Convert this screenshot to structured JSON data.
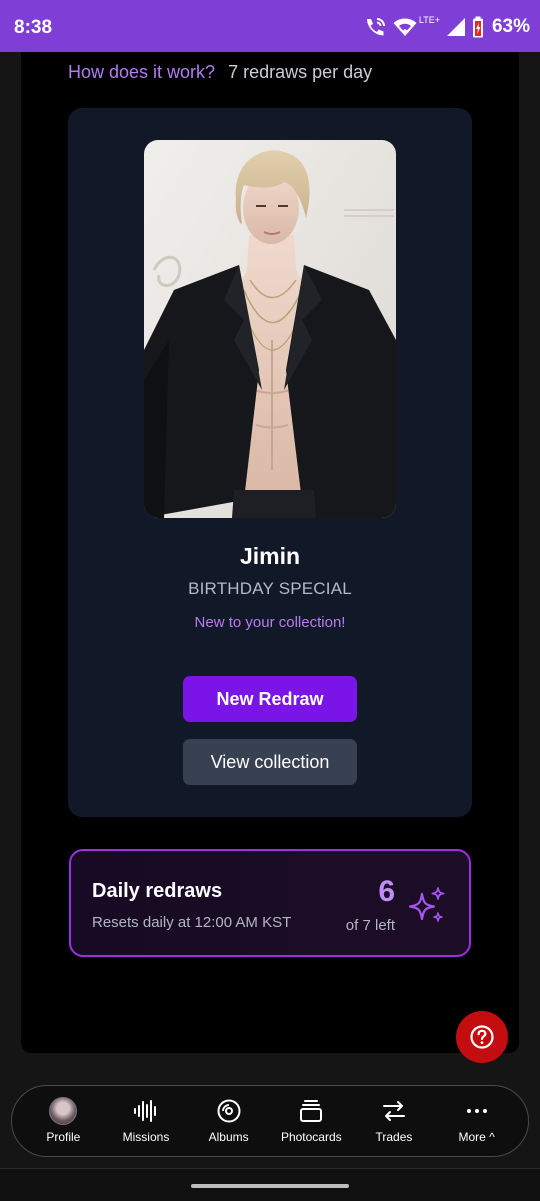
{
  "status_bar": {
    "time": "8:38",
    "network": "LTE+",
    "battery": "63%"
  },
  "info": {
    "how_link": "How does it work?",
    "redraws_per_day": "7 redraws per day"
  },
  "card": {
    "member": "Jimin",
    "version": "BIRTHDAY SPECIAL",
    "status": "New to your collection!",
    "new_redraw_label": "New Redraw",
    "view_collection_label": "View collection"
  },
  "daily": {
    "title": "Daily redraws",
    "subtitle": "Resets daily at 12:00 AM KST",
    "count": "6",
    "of_left": "of 7 left"
  },
  "nav": {
    "items": [
      {
        "label": "Profile",
        "icon": "avatar"
      },
      {
        "label": "Missions",
        "icon": "audio-wave-icon"
      },
      {
        "label": "Albums",
        "icon": "disc-icon"
      },
      {
        "label": "Photocards",
        "icon": "cards-stack-icon"
      },
      {
        "label": "Trades",
        "icon": "swap-arrows-icon"
      },
      {
        "label": "More ^",
        "icon": "more-dots-icon"
      }
    ]
  },
  "colors": {
    "accent": "#7b14e6",
    "status_bar": "#7f3fd6",
    "help": "#c40d10"
  }
}
